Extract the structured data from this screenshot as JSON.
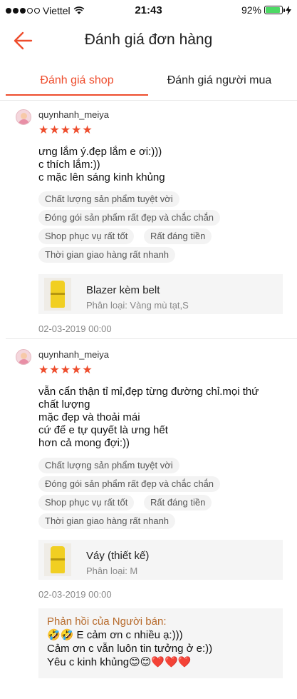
{
  "status": {
    "carrier": "Viettel",
    "time": "21:43",
    "battery": "92%",
    "battery_level": 0.92
  },
  "header": {
    "title": "Đánh giá đơn hàng"
  },
  "tabs": [
    {
      "label": "Đánh giá shop",
      "active": true
    },
    {
      "label": "Đánh giá người mua",
      "active": false
    }
  ],
  "reviews": [
    {
      "username": "quynhanh_meiya",
      "rating": 5,
      "comment": [
        "ưng lắm ý.đẹp lắm e ơi:)))",
        "c thích lắm:))",
        "c mặc lên sáng kinh khủng"
      ],
      "tags": [
        "Chất lượng sản phẩm tuyệt vời",
        "Đóng gói sản phẩm rất đẹp và chắc chắn",
        "Shop phục vụ rất tốt",
        "Rất đáng tiền",
        "Thời gian giao hàng rất nhanh"
      ],
      "product": {
        "name": "Blazer kèm belt",
        "variant": "Phân loại: Vàng mù tạt,S"
      },
      "date": "02-03-2019 00:00"
    },
    {
      "username": "quynhanh_meiya",
      "rating": 5,
      "comment": [
        "vẫn cẩn thận tỉ mỉ,đẹp từng đường chỉ.mọi thứ",
        "chất lượng",
        "mặc đẹp và thoải mái",
        "cứ để e tự quyết là ưng hết",
        "hơn cả mong đợi:))"
      ],
      "tags": [
        "Chất lượng sản phẩm tuyệt vời",
        "Đóng gói sản phẩm rất đẹp và chắc chắn",
        "Shop phục vụ rất tốt",
        "Rất đáng tiền",
        "Thời gian giao hàng rất nhanh"
      ],
      "product": {
        "name": "Váy (thiết kế)",
        "variant": "Phân loại: M"
      },
      "date": "02-03-2019 00:00",
      "seller_reply": {
        "title": "Phản hồi của Người bán:",
        "lines": [
          "🤣🤣 E cảm ơn c nhiều ạ:)))",
          "Cảm ơn c vẫn luôn tin tưởng ở e:))",
          "Yêu c kinh khủng😊😊❤️❤️❤️"
        ]
      }
    }
  ],
  "colors": {
    "accent": "#ee4d2d",
    "tag_bg": "#f3f3f3",
    "product_bg": "#f5f5f5",
    "reply_title": "#b76a2b"
  }
}
